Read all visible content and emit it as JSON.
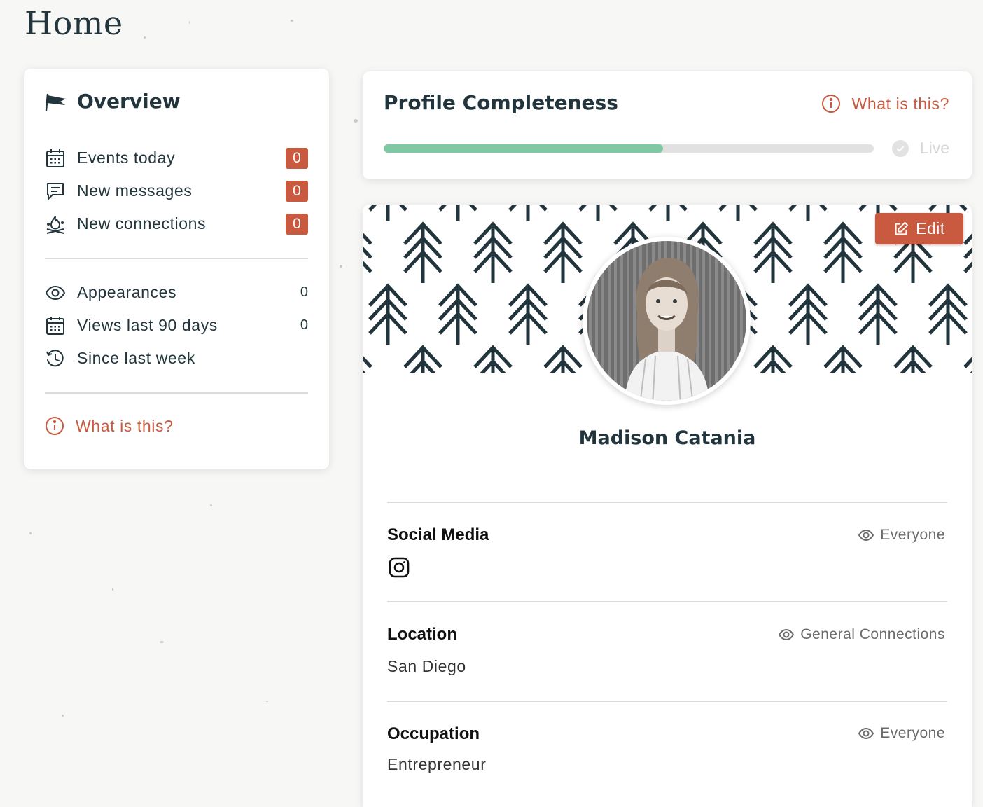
{
  "page": {
    "title": "Home"
  },
  "overview": {
    "title": "Overview",
    "activity": [
      {
        "icon": "calendar-icon",
        "label": "Events today",
        "count": "0"
      },
      {
        "icon": "message-icon",
        "label": "New messages",
        "count": "0"
      },
      {
        "icon": "campfire-icon",
        "label": "New connections",
        "count": "0"
      }
    ],
    "stats": [
      {
        "icon": "eye-icon",
        "label": "Appearances",
        "count": "0"
      },
      {
        "icon": "calendar-icon",
        "label": "Views last 90 days",
        "count": "0"
      },
      {
        "icon": "history-icon",
        "label": "Since last week",
        "count": ""
      }
    ],
    "info_link": "What is this?"
  },
  "completeness": {
    "title": "Profile Completeness",
    "info_link": "What is this?",
    "progress": 0.57,
    "status": "Live"
  },
  "profile": {
    "edit_label": "Edit",
    "name": "Madison Catania",
    "sections": {
      "social": {
        "title": "Social Media",
        "visibility": "Everyone",
        "icon": "instagram-icon"
      },
      "location": {
        "title": "Location",
        "visibility": "General Connections",
        "value": "San Diego"
      },
      "occupation": {
        "title": "Occupation",
        "visibility": "Everyone",
        "value": "Entrepreneur"
      }
    }
  },
  "colors": {
    "accent": "#c95a3f",
    "progress": "#7ec9a3",
    "text_dark": "#22343c"
  }
}
